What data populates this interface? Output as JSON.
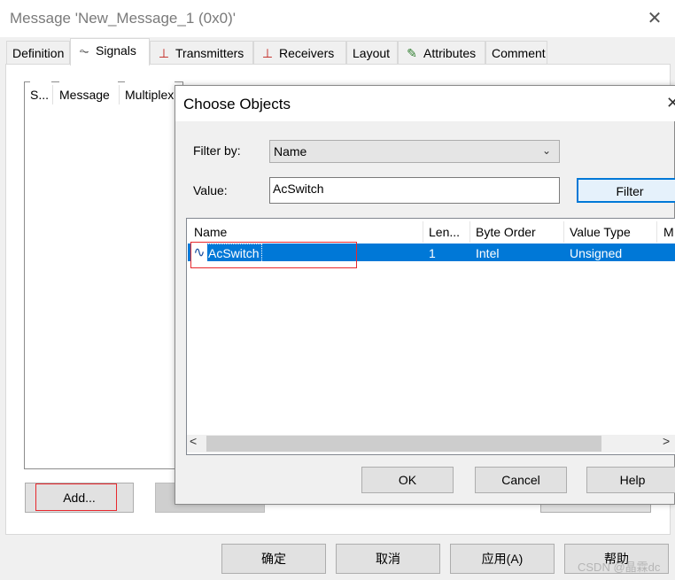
{
  "window": {
    "title": "Message 'New_Message_1 (0x0)'",
    "close_glyph": "✕",
    "tabs": [
      {
        "label": "Definition",
        "icon": ""
      },
      {
        "label": "Signals",
        "icon": "signal-wave-icon",
        "glyph": "⏦"
      },
      {
        "label": "Transmitters",
        "icon": "transmitter-icon",
        "glyph": "⊥"
      },
      {
        "label": "Receivers",
        "icon": "receiver-icon",
        "glyph": "⊥"
      },
      {
        "label": "Layout",
        "icon": ""
      },
      {
        "label": "Attributes",
        "icon": "attributes-pen-icon",
        "glyph": "✎"
      },
      {
        "label": "Comment",
        "icon": ""
      }
    ],
    "active_tab": "Signals",
    "signals_columns": [
      "S...",
      "Message",
      "Multiplex"
    ],
    "add_button": "Add...",
    "footer": {
      "ok": "确定",
      "cancel": "取消",
      "apply": "应用(A)",
      "help": "帮助"
    }
  },
  "dialog": {
    "title": "Choose Objects",
    "close_glyph": "✕",
    "filter_by_label": "Filter by:",
    "filter_by_value": "Name",
    "value_label": "Value:",
    "value_input": "AcSwitch",
    "filter_button": "Filter",
    "columns": [
      "Name",
      "Len...",
      "Byte Order",
      "Value Type",
      "M"
    ],
    "rows": [
      {
        "name": "AcSwitch",
        "length": "1",
        "byte_order": "Intel",
        "value_type": "Unsigned",
        "icon": "signal-wave-icon",
        "glyph": "∿"
      }
    ],
    "scroll_left": "<",
    "scroll_right": ">",
    "ok": "OK",
    "cancel": "Cancel",
    "help": "Help"
  },
  "watermark": "CSDN @晶霖dc",
  "colors": {
    "selection": "#0078d7",
    "highlight_box": "#e8282d",
    "icon_red": "#c0201a"
  }
}
